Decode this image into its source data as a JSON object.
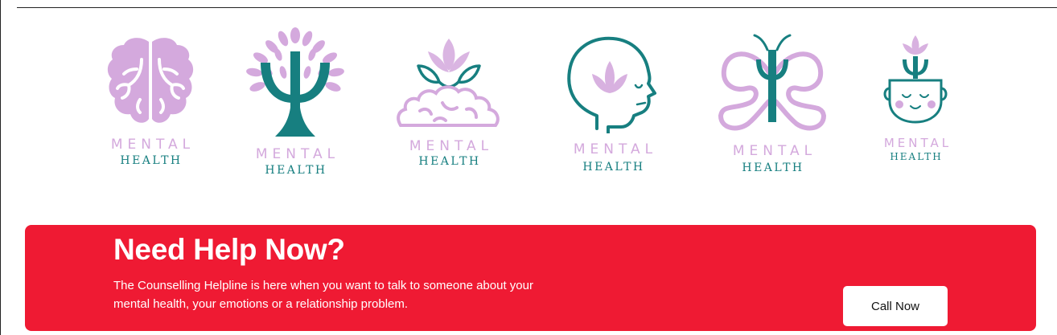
{
  "colors": {
    "lavender": "#d4a9dd",
    "teal": "#177f80",
    "banner": "#ef1a33",
    "white": "#ffffff"
  },
  "logos": [
    {
      "icon": "brain-icon",
      "word1": "MENTAL",
      "word2": "HEALTH"
    },
    {
      "icon": "psi-tree-icon",
      "word1": "MENTAL",
      "word2": "HEALTH"
    },
    {
      "icon": "lotus-brain-icon",
      "word1": "MENTAL",
      "word2": "HEALTH"
    },
    {
      "icon": "head-lotus-icon",
      "word1": "MENTAL",
      "word2": "HEALTH"
    },
    {
      "icon": "butterfly-psi-icon",
      "word1": "MENTAL",
      "word2": "HEALTH"
    },
    {
      "icon": "pot-face-icon",
      "word1": "MENTAL",
      "word2": "HEALTH"
    }
  ],
  "help": {
    "title": "Need Help Now?",
    "text": "The Counselling Helpline is here when you want to talk to someone about your mental health, your emotions or a relationship problem.",
    "button_label": "Call Now"
  }
}
